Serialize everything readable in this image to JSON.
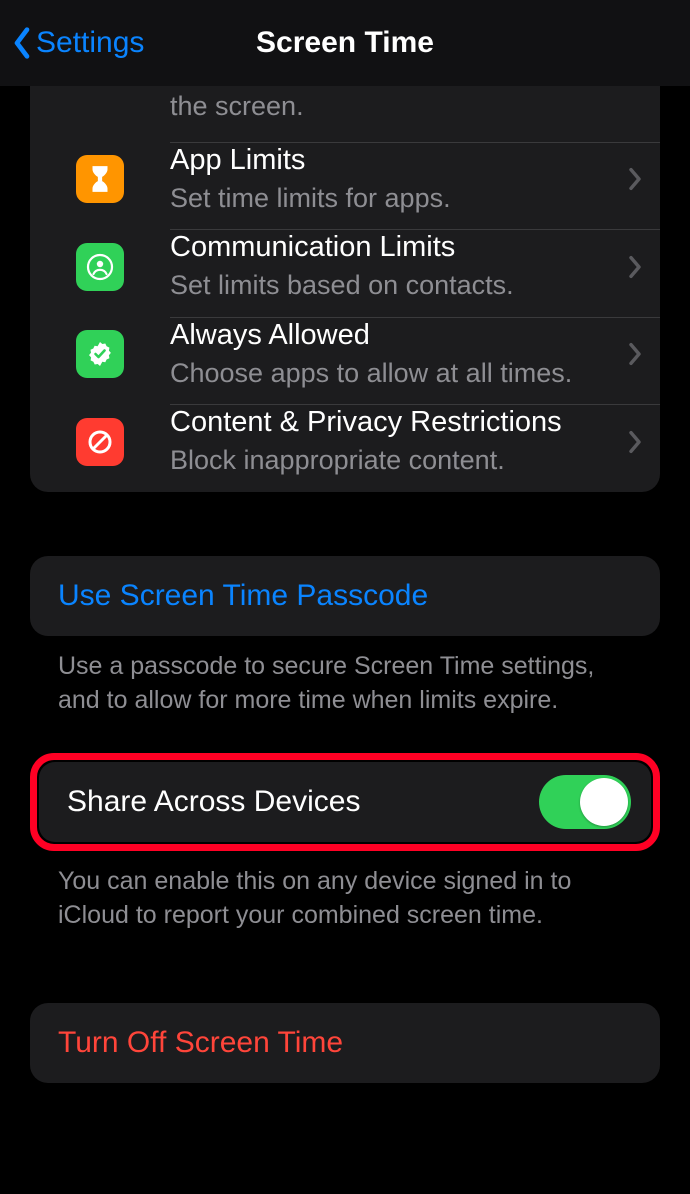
{
  "nav": {
    "back_label": "Settings",
    "title": "Screen Time"
  },
  "rows": {
    "partial": {
      "subtitle": "the screen."
    },
    "limits": {
      "title": "App Limits",
      "subtitle": "Set time limits for apps."
    },
    "comm": {
      "title": "Communication Limits",
      "subtitle": "Set limits based on contacts."
    },
    "allowed": {
      "title": "Always Allowed",
      "subtitle": "Choose apps to allow at all times."
    },
    "content": {
      "title": "Content & Privacy Restrictions",
      "subtitle": "Block inappropriate content."
    }
  },
  "passcode": {
    "label": "Use Screen Time Passcode",
    "footer": "Use a passcode to secure Screen Time settings, and to allow for more time when limits expire."
  },
  "share": {
    "label": "Share Across Devices",
    "footer": "You can enable this on any device signed in to iCloud to report your combined screen time."
  },
  "turnoff": {
    "label": "Turn Off Screen Time"
  }
}
